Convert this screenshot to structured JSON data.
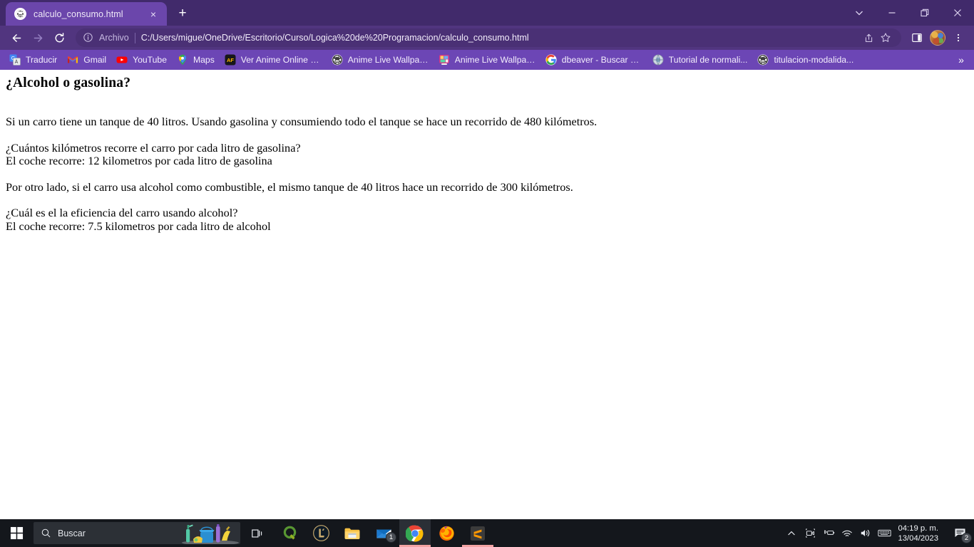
{
  "window": {
    "controls": {
      "tab_search": "tab-search-chevron",
      "minimize": "minimize",
      "maximize": "maximize",
      "close": "close"
    }
  },
  "tabstrip": {
    "tabs": [
      {
        "title": "calculo_consumo.html",
        "favicon": "globe-icon",
        "close_label": "×",
        "active": true
      }
    ],
    "new_tab_label": "+"
  },
  "toolbar": {
    "back_label": "←",
    "forward_label": "→",
    "reload_label": "↻",
    "omnibox": {
      "info_icon": "info-circle-icon",
      "scheme_label": "Archivo",
      "url": "C:/Users/migue/OneDrive/Escritorio/Curso/Logica%20de%20Programacion/calculo_consumo.html",
      "share_icon": "share-icon",
      "bookmark_icon": "star-icon"
    },
    "side_panel_icon": "side-panel-icon",
    "profile": "avatar",
    "menu_icon": "three-dot-menu-icon"
  },
  "bookmarks": {
    "items": [
      {
        "label": "Traducir",
        "icon": "google-translate-icon"
      },
      {
        "label": "Gmail",
        "icon": "gmail-icon"
      },
      {
        "label": "YouTube",
        "icon": "youtube-icon"
      },
      {
        "label": "Maps",
        "icon": "google-maps-icon"
      },
      {
        "label": "Ver Anime Online H...",
        "icon": "animeflv-icon"
      },
      {
        "label": "Anime Live Wallpap...",
        "icon": "globe-icon"
      },
      {
        "label": "Anime Live Wallpap...",
        "icon": "wallpaper-app-icon"
      },
      {
        "label": "dbeaver - Buscar co...",
        "icon": "google-g-icon"
      },
      {
        "label": "Tutorial de normali...",
        "icon": "generic-site-icon"
      },
      {
        "label": "titulacion-modalida...",
        "icon": "globe-icon"
      }
    ],
    "overflow_label": "»"
  },
  "page": {
    "heading": "¿Alcohol o gasolina?",
    "paragraphs": [
      {
        "text": "Si un carro tiene un tanque de 40 litros. Usando gasolina y consumiendo todo el tanque se hace un recorrido de 480 kilómetros."
      },
      {
        "text": "¿Cuántos kilómetros recorre el carro por cada litro de gasolina?"
      },
      {
        "text": "El coche recorre: 12 kilometros por cada litro de gasolina"
      },
      {
        "text": "Por otro lado, si el carro usa alcohol como combustible, el mismo tanque de 40 litros hace un recorrido de 300 kilómetros."
      },
      {
        "text": "¿Cuál es el la eficiencia del carro usando alcohol?"
      },
      {
        "text": "El coche recorre: 7.5 kilometros por cada litro de alcohol"
      }
    ]
  },
  "taskbar": {
    "start_icon": "windows-start-icon",
    "search": {
      "placeholder": "Buscar",
      "icon": "search-icon"
    },
    "task_view_icon": "task-view-icon",
    "apps": [
      {
        "name": "qgis",
        "icon": "qgis-icon",
        "active": false,
        "badge": ""
      },
      {
        "name": "league",
        "icon": "league-of-legends-icon",
        "active": false,
        "badge": ""
      },
      {
        "name": "explorer",
        "icon": "file-explorer-icon",
        "active": false,
        "badge": ""
      },
      {
        "name": "mail",
        "icon": "mail-icon",
        "active": false,
        "badge": "1"
      },
      {
        "name": "chrome",
        "icon": "chrome-icon",
        "active": true,
        "badge": ""
      },
      {
        "name": "firefox",
        "icon": "firefox-icon",
        "active": false,
        "badge": ""
      },
      {
        "name": "sublime",
        "icon": "sublime-text-icon",
        "active": false,
        "badge": ""
      }
    ],
    "tray": {
      "icons": [
        "chevron-up-icon",
        "meet-camera-icon",
        "bluetooth-battery-icon",
        "wifi-icon",
        "volume-icon",
        "keyboard-icon"
      ],
      "time": "04:19 p. m.",
      "date": "13/04/2023",
      "notifications_icon": "notifications-icon",
      "notifications_badge": "2"
    }
  },
  "colors": {
    "tabstrip_bg": "#412a6b",
    "tab_active_bg": "#6b46ab",
    "toolbar_bg": "#51357f",
    "omnibox_bg": "#4a3075",
    "bookmarks_bg": "#6c46b5",
    "page_bg": "#ffffff",
    "taskbar_bg": "#14171c",
    "taskbar_active_underline": "#f3a3a3"
  }
}
